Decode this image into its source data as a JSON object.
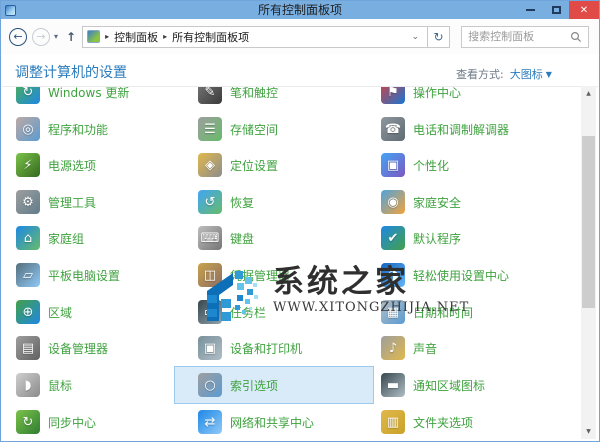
{
  "window": {
    "title": "所有控制面板项"
  },
  "toolbar": {
    "breadcrumb": {
      "root": "控制面板",
      "current": "所有控制面板项"
    },
    "search": {
      "placeholder": "搜索控制面板"
    }
  },
  "header": {
    "title": "调整计算机的设置",
    "view_by_label": "查看方式:",
    "view_by_value": "大图标"
  },
  "glyphs": {
    "close": "✕",
    "back": "←",
    "forward": "→",
    "caret_down": "▾",
    "up": "↑",
    "crumb_sep": "▸",
    "addr_chevron": "⌄",
    "refresh": "↻",
    "scroll_up": "▲",
    "scroll_down": "▼",
    "view_caret": "▼"
  },
  "watermark": {
    "title": "系统之家",
    "url": "WWW.XITONGZHIJIA.NET"
  },
  "colors": {
    "titlebar": "#79AEE1",
    "close_button": "#E14B47",
    "header_blue": "#2B7BBD",
    "item_label_green": "#3FA23F",
    "selected_fill": "#D9EBF9",
    "selected_border": "#9CCBEE"
  },
  "grid": {
    "items": [
      {
        "icon": "windows-update",
        "label": "Windows 更新",
        "glyph": "↻",
        "colors": [
          "#4CAF50",
          "#1E88E5"
        ]
      },
      {
        "icon": "pen-and-touch",
        "label": "笔和触控",
        "glyph": "✎",
        "colors": [
          "#787878",
          "#3A3A3A"
        ]
      },
      {
        "icon": "action-center",
        "label": "操作中心",
        "glyph": "⚑",
        "colors": [
          "#D34040",
          "#1976D2"
        ]
      },
      {
        "icon": "programs-and-features",
        "label": "程序和功能",
        "glyph": "◎",
        "colors": [
          "#BCAAA4",
          "#5C9BD1"
        ]
      },
      {
        "icon": "storage-spaces",
        "label": "存储空间",
        "glyph": "☰",
        "colors": [
          "#9E9E9E",
          "#66BB6A"
        ]
      },
      {
        "icon": "phone-and-modem",
        "label": "电话和调制解调器",
        "glyph": "☎",
        "colors": [
          "#8E979E",
          "#5F6A72"
        ]
      },
      {
        "icon": "power-options",
        "label": "电源选项",
        "glyph": "⚡",
        "colors": [
          "#7CC24B",
          "#33691E"
        ]
      },
      {
        "icon": "location-settings",
        "label": "定位设置",
        "glyph": "◈",
        "colors": [
          "#E0B84C",
          "#8D8D8D"
        ]
      },
      {
        "icon": "personalization",
        "label": "个性化",
        "glyph": "▣",
        "colors": [
          "#42A5F5",
          "#7E57C2"
        ]
      },
      {
        "icon": "administrative-tools",
        "label": "管理工具",
        "glyph": "⚙",
        "colors": [
          "#9E9E9E",
          "#607D8B"
        ]
      },
      {
        "icon": "recovery",
        "label": "恢复",
        "glyph": "↺",
        "colors": [
          "#42A5F5",
          "#66BB6A"
        ]
      },
      {
        "icon": "family-safety",
        "label": "家庭安全",
        "glyph": "◉",
        "colors": [
          "#4FA3DD",
          "#F2A33C"
        ]
      },
      {
        "icon": "homegroup",
        "label": "家庭组",
        "glyph": "⌂",
        "colors": [
          "#1E88E5",
          "#66BB6A"
        ]
      },
      {
        "icon": "keyboard",
        "label": "键盘",
        "glyph": "⌨",
        "colors": [
          "#BDBDBD",
          "#757575"
        ]
      },
      {
        "icon": "default-programs",
        "label": "默认程序",
        "glyph": "✔",
        "colors": [
          "#1E88E5",
          "#43A047"
        ]
      },
      {
        "icon": "tablet-pc-settings",
        "label": "平板电脑设置",
        "glyph": "▱",
        "colors": [
          "#546E7A",
          "#90CAF9"
        ]
      },
      {
        "icon": "credential-manager",
        "label": "凭据管理器",
        "glyph": "◫",
        "colors": [
          "#C8A24B",
          "#8D6E63"
        ]
      },
      {
        "icon": "ease-of-access-center",
        "label": "轻松使用设置中心",
        "glyph": "◑",
        "colors": [
          "#1565C0",
          "#64B5F6"
        ]
      },
      {
        "icon": "region",
        "label": "区域",
        "glyph": "⊕",
        "colors": [
          "#43A047",
          "#1E88E5"
        ]
      },
      {
        "icon": "taskbar",
        "label": "任务栏",
        "glyph": "▭",
        "colors": [
          "#37474F",
          "#90A4AE"
        ]
      },
      {
        "icon": "date-and-time",
        "label": "日期和时间",
        "glyph": "▦",
        "colors": [
          "#B0BEC5",
          "#5C9BD1"
        ]
      },
      {
        "icon": "device-manager",
        "label": "设备管理器",
        "glyph": "▤",
        "colors": [
          "#9E9E9E",
          "#616161"
        ]
      },
      {
        "icon": "devices-and-printers",
        "label": "设备和打印机",
        "glyph": "▣",
        "colors": [
          "#78909C",
          "#B0BEC5"
        ]
      },
      {
        "icon": "sound",
        "label": "声音",
        "glyph": "♪",
        "colors": [
          "#9E9E9E",
          "#E0B84C"
        ]
      },
      {
        "icon": "mouse",
        "label": "鼠标",
        "glyph": "◗",
        "colors": [
          "#CFCFCF",
          "#8A8A8A"
        ]
      },
      {
        "icon": "indexing-options",
        "label": "索引选项",
        "glyph": "○",
        "colors": [
          "#9E9E9E",
          "#5C9BD1"
        ],
        "selected": true
      },
      {
        "icon": "notification-area-icons",
        "label": "通知区域图标",
        "glyph": "▬",
        "colors": [
          "#37474F",
          "#B0BEC5"
        ]
      },
      {
        "icon": "sync-center",
        "label": "同步中心",
        "glyph": "↻",
        "colors": [
          "#7CC24B",
          "#2E7D32"
        ]
      },
      {
        "icon": "network-sharing-center",
        "label": "网络和共享中心",
        "glyph": "⇄",
        "colors": [
          "#1E88E5",
          "#90CAF9"
        ]
      },
      {
        "icon": "folder-options",
        "label": "文件夹选项",
        "glyph": "▥",
        "colors": [
          "#E0B84C",
          "#C9A227"
        ]
      }
    ]
  }
}
